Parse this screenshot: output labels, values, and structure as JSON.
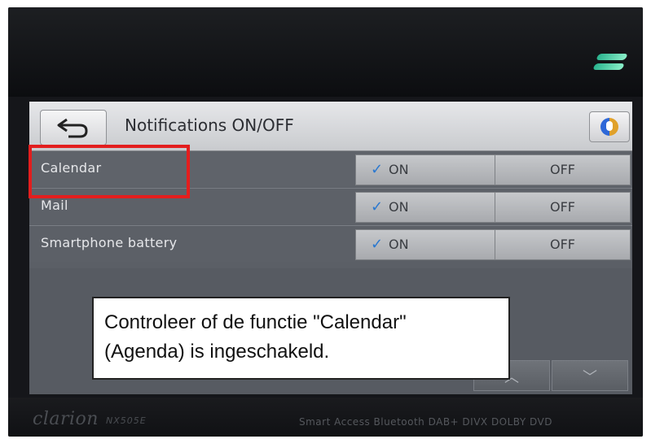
{
  "header": {
    "title": "Notifications ON/OFF",
    "back_icon": "back-arrow-icon",
    "mic_icon": "microphone-icon"
  },
  "rows": [
    {
      "label": "Calendar",
      "on_label": "ON",
      "off_label": "OFF",
      "selected": "ON"
    },
    {
      "label": "Mail",
      "on_label": "ON",
      "off_label": "OFF",
      "selected": "ON"
    },
    {
      "label": "Smartphone battery",
      "on_label": "ON",
      "off_label": "OFF",
      "selected": "ON"
    }
  ],
  "scroll": {
    "up_icon": "chevron-up-icon",
    "down_icon": "chevron-down-icon"
  },
  "device": {
    "brand": "clarion",
    "model": "NX505E",
    "features": "Smart Access  Bluetooth  DAB+  DIVX  DOLBY  DVD"
  },
  "callout": {
    "line1": "Controleer of de functie \"Calendar\"",
    "line2": "(Agenda) is ingeschakeld."
  },
  "colors": {
    "highlight": "#e31e1e",
    "check": "#2a78d0"
  }
}
